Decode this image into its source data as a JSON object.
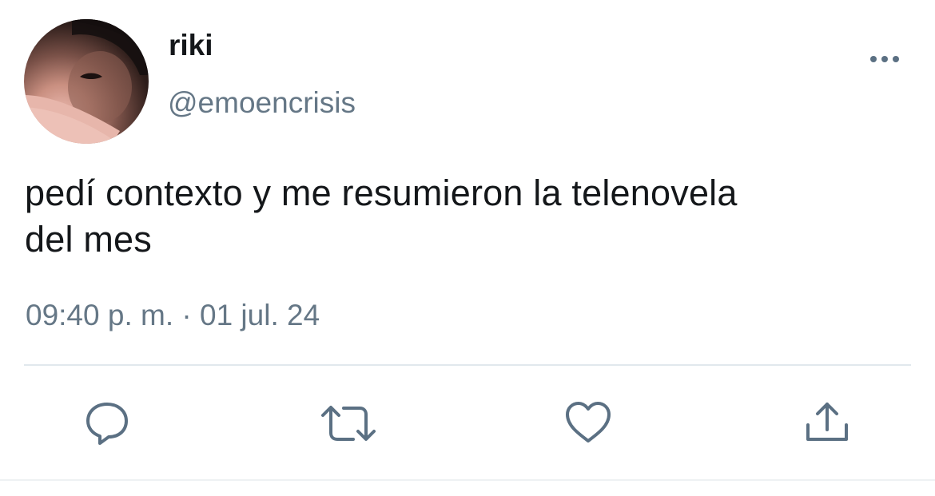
{
  "tweet": {
    "display_name": "riki",
    "handle": "@emoencrisis",
    "text_line1": "pedí contexto y me resumieron la telenovela",
    "text_line2": "del mes",
    "timestamp": "09:40 p. m. · 01 jul. 24"
  },
  "icons": {
    "more": "more-horizontal-icon",
    "reply": "reply-bubble-icon",
    "retweet": "retweet-icon",
    "like": "heart-icon",
    "share": "share-upload-icon"
  },
  "colors": {
    "text": "#14171a",
    "secondary": "#657786",
    "icon": "#5b7083",
    "divider": "#e1e8ed"
  }
}
